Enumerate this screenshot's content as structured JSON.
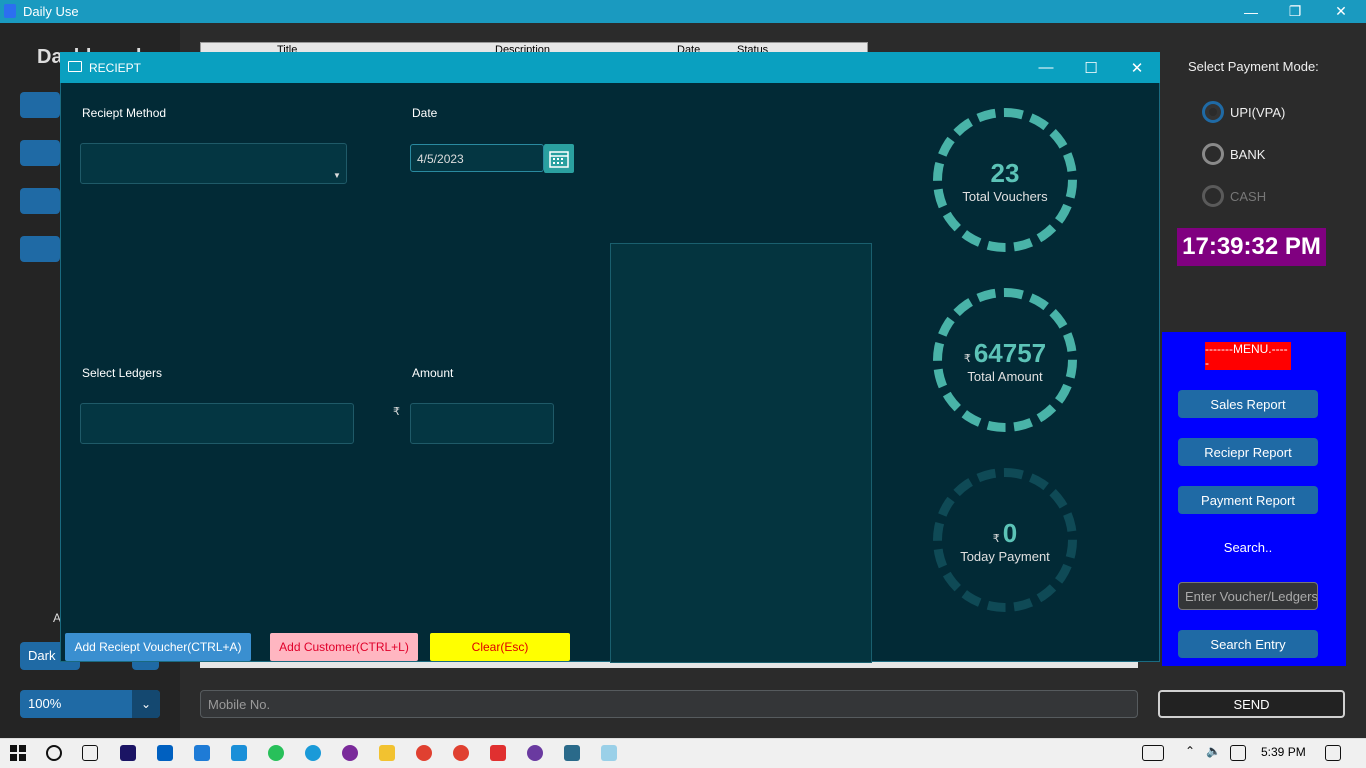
{
  "app": {
    "title": "Daily Use"
  },
  "sidebar": {
    "heading": "Dashboard",
    "appearance_initial": "A",
    "theme_value": "Dark",
    "zoom_value": "100%"
  },
  "table": {
    "headers": [
      "Title",
      "Description",
      "Date",
      "Status"
    ]
  },
  "payment": {
    "label": "Select Payment Mode:",
    "options": [
      {
        "label": "UPI(VPA)",
        "selected": true
      },
      {
        "label": "BANK",
        "selected": false
      },
      {
        "label": "CASH",
        "selected": false
      }
    ],
    "clock": "17:39:32 PM"
  },
  "menu": {
    "title": "-------MENU.-----",
    "buttons": [
      "Sales Report",
      "Reciepr Report",
      "Payment Report"
    ],
    "search_label": "Search..",
    "search_placeholder": "Enter Voucher/Ledgers",
    "search_button": "Search Entry"
  },
  "bottom": {
    "mobile_placeholder": "Mobile No.",
    "send_label": "SEND"
  },
  "dialog": {
    "title": "RECIEPT",
    "method_label": "Reciept Method",
    "date_label": "Date",
    "date_value": "4/5/2023",
    "ledgers_label": "Select Ledgers",
    "amount_label": "Amount",
    "currency": "₹",
    "stats": [
      {
        "value": "23",
        "label": "Total Vouchers"
      },
      {
        "value": "64757",
        "label": "Total Amount",
        "currency": "₹"
      },
      {
        "value": "0",
        "label": "Today Payment",
        "currency": "₹"
      }
    ],
    "buttons": {
      "add_voucher": "Add Reciept Voucher(CTRL+A)",
      "add_customer": "Add Customer(CTRL+L)",
      "clear": "Clear(Esc)"
    }
  },
  "taskbar": {
    "time": "5:39 PM"
  },
  "colors": {
    "accent": "#1f6aa5",
    "ring": "#49b3a8",
    "menu_bg": "#0000ff",
    "clock_bg": "#800080"
  }
}
